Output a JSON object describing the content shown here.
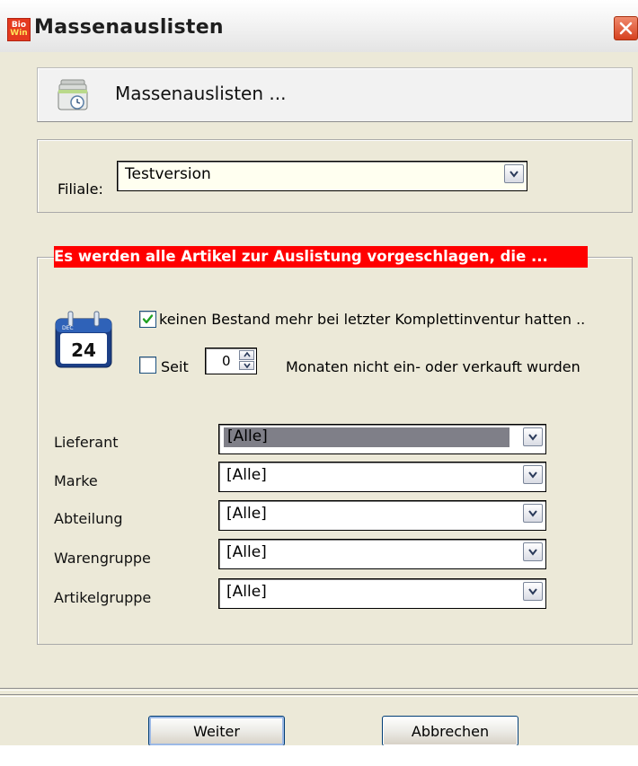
{
  "window": {
    "title": "Massenauslisten",
    "logo_top": "Bio",
    "logo_bottom": "Win",
    "close_icon": "close-icon"
  },
  "header": {
    "icon": "clock-stack-icon",
    "title": "Massenauslisten ..."
  },
  "filiale": {
    "label": "Filiale:",
    "value": "Testversion"
  },
  "criteria": {
    "banner": "Es werden alle Artikel zur Auslistung vorgeschlagen, die ...",
    "calendar": {
      "month": "DEC",
      "day": "24"
    },
    "option1": {
      "checked": true,
      "label": "keinen Bestand mehr bei letzter Komplettinventur hatten .."
    },
    "option2": {
      "checked": false,
      "label_prefix": "Seit",
      "months_value": "0",
      "label_suffix": "Monaten nicht ein- oder verkauft wurden"
    }
  },
  "filters": [
    {
      "label": "Lieferant",
      "value": "[Alle]"
    },
    {
      "label": "Marke",
      "value": "[Alle]"
    },
    {
      "label": "Abteilung",
      "value": "[Alle]"
    },
    {
      "label": "Warengruppe",
      "value": "[Alle]"
    },
    {
      "label": "Artikelgruppe",
      "value": "[Alle]"
    }
  ],
  "buttons": {
    "next": "Weiter",
    "cancel": "Abbrechen"
  },
  "colors": {
    "banner_bg": "#ff0000",
    "banner_text": "#ffffff",
    "checkmark": "#21a121"
  }
}
